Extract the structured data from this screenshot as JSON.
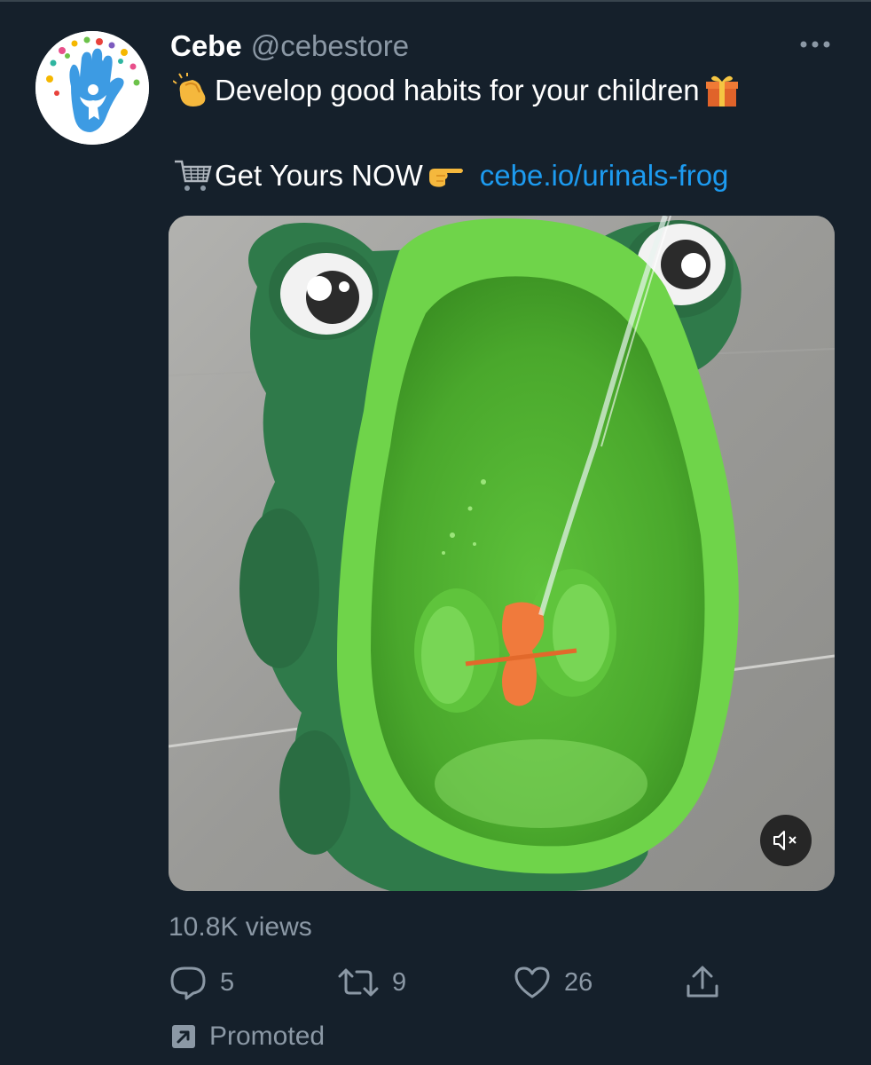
{
  "tweet": {
    "author": {
      "display_name": "Cebe",
      "handle": "@cebestore",
      "avatar_icon": "hand-logo-icon"
    },
    "text": {
      "line1": "Develop good habits for your children",
      "line2": "Get Yours NOW",
      "link": "cebe.io/urinals-frog"
    },
    "emojis": {
      "clap": "clapping-hands-icon",
      "gift": "gift-icon",
      "cart": "shopping-cart-icon",
      "pointing": "pointing-right-icon"
    },
    "media": {
      "type": "video",
      "icon": "mute-icon"
    },
    "views": "10.8K views",
    "actions": {
      "reply_count": "5",
      "retweet_count": "9",
      "like_count": "26"
    },
    "promoted_label": "Promoted"
  },
  "colors": {
    "background": "#15202b",
    "text_primary": "#ffffff",
    "text_secondary": "#8b98a5",
    "link": "#1d9bf0",
    "divider": "#38444d"
  }
}
